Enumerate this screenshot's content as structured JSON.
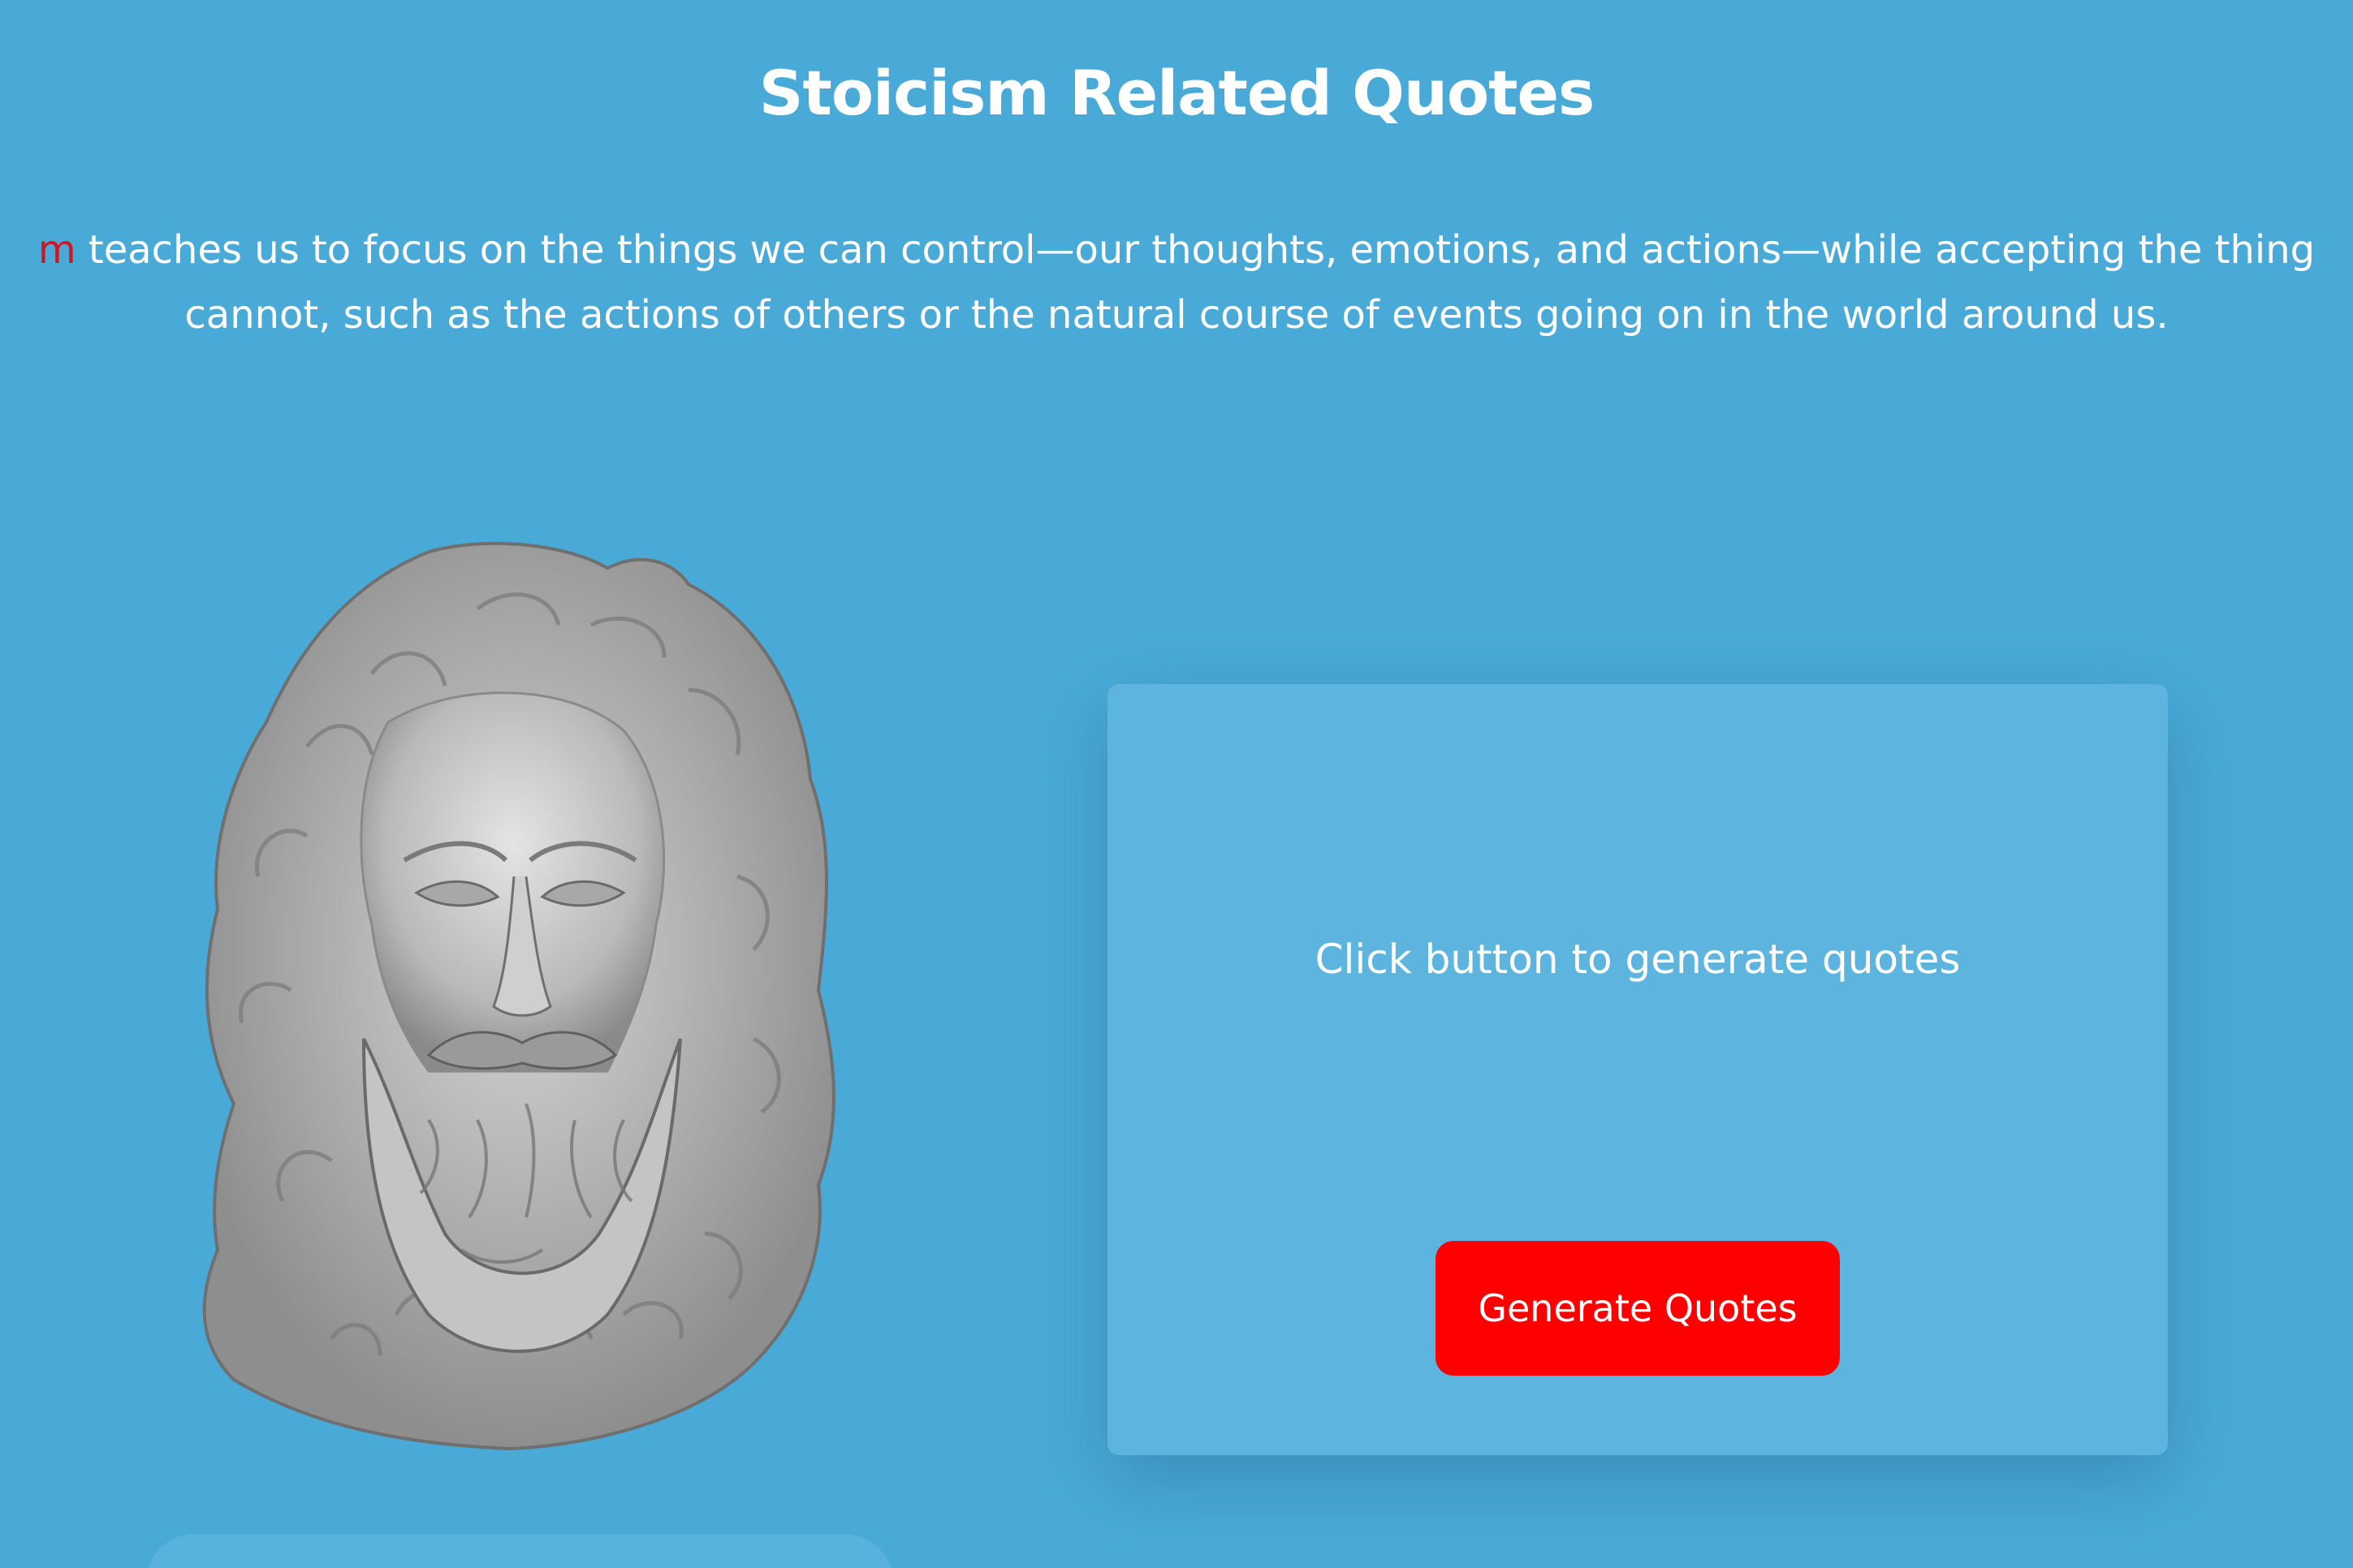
{
  "header": {
    "title": "Stoicism Related Quotes"
  },
  "intro": {
    "highlight": "m",
    "line1": " teaches us to focus on the things we can control—our thoughts, emotions, and actions—while accepting the thing",
    "line2": "cannot, such as the actions of others or the natural course of events going on in the world around us."
  },
  "quote_card": {
    "placeholder_text": "Click button to generate quotes",
    "button_label": "Generate Quotes"
  },
  "colors": {
    "background": "#4aaad7",
    "card": "#5db5df",
    "button": "#ff0000",
    "highlight": "#d0161e"
  }
}
